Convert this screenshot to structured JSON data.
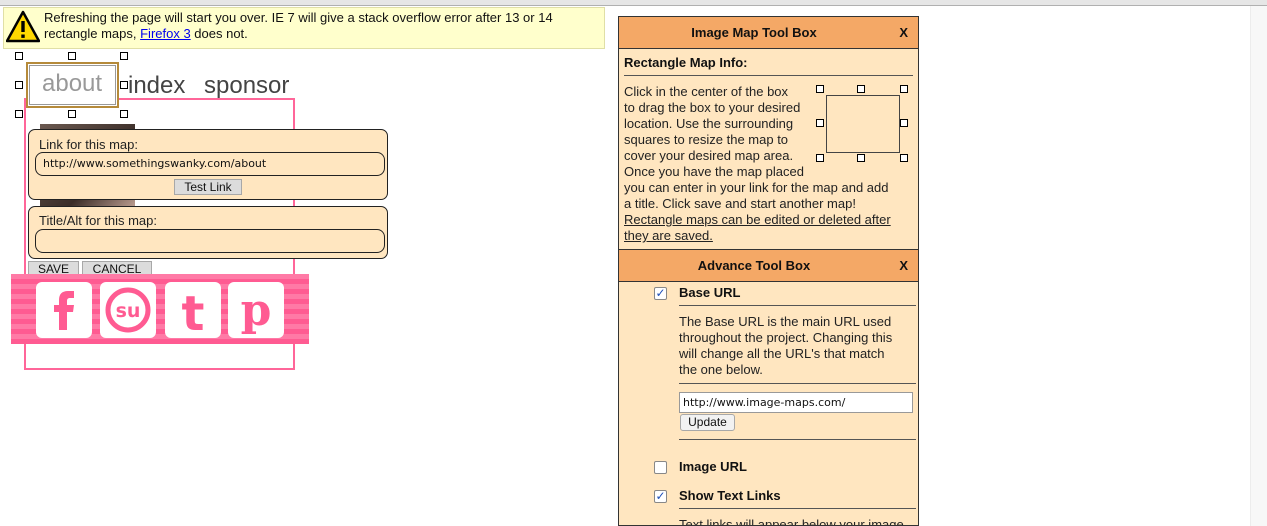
{
  "warning": {
    "text_before": "Refreshing the page will start you over. IE 7 will give a stack overflow error after 13 or 14 rectangle maps, ",
    "link": "Firefox 3",
    "text_after": " does not."
  },
  "canvas": {
    "map_label": "about",
    "nav_index": "index",
    "nav_sponsor": "sponsor"
  },
  "map_editor": {
    "link_label": "Link for this map:",
    "link_value": "http://www.somethingswanky.com/about",
    "test_link": "Test Link",
    "title_label": "Title/Alt for this map:",
    "title_value": "",
    "save": "SAVE",
    "cancel": "CANCEL"
  },
  "social": [
    "facebook-icon",
    "stumbleupon-icon",
    "tumblr-icon",
    "pinterest-icon"
  ],
  "toolbox": {
    "title": "Image Map Tool Box",
    "close": "X",
    "rect_info_title": "Rectangle Map Info:",
    "rect_info_lines": [
      "Click in the center of the box",
      "to drag the box to your desired",
      "location. Use the surrounding",
      "squares to resize the map to",
      "cover your desired map area.",
      "Once you have the map placed",
      "you can enter in your link for the map and add",
      "a title. Click save and start another map!"
    ],
    "rect_info_note_1": "Rectangle maps can be edited or deleted after",
    "rect_info_note_2": "they are saved."
  },
  "advance": {
    "title": "Advance Tool Box",
    "close": "X",
    "base_url_label": "Base URL",
    "base_url_checked": true,
    "base_url_desc": [
      "The Base URL is the main URL used",
      "throughout the project. Changing this",
      "will change all the URL's that match",
      "the one below."
    ],
    "base_url_value": "http://www.image-maps.com/",
    "update": "Update",
    "image_url_label": "Image URL",
    "image_url_checked": false,
    "show_text_links_label": "Show Text Links",
    "show_text_links_checked": true,
    "text_links_desc": "Text links will appear below your image"
  }
}
